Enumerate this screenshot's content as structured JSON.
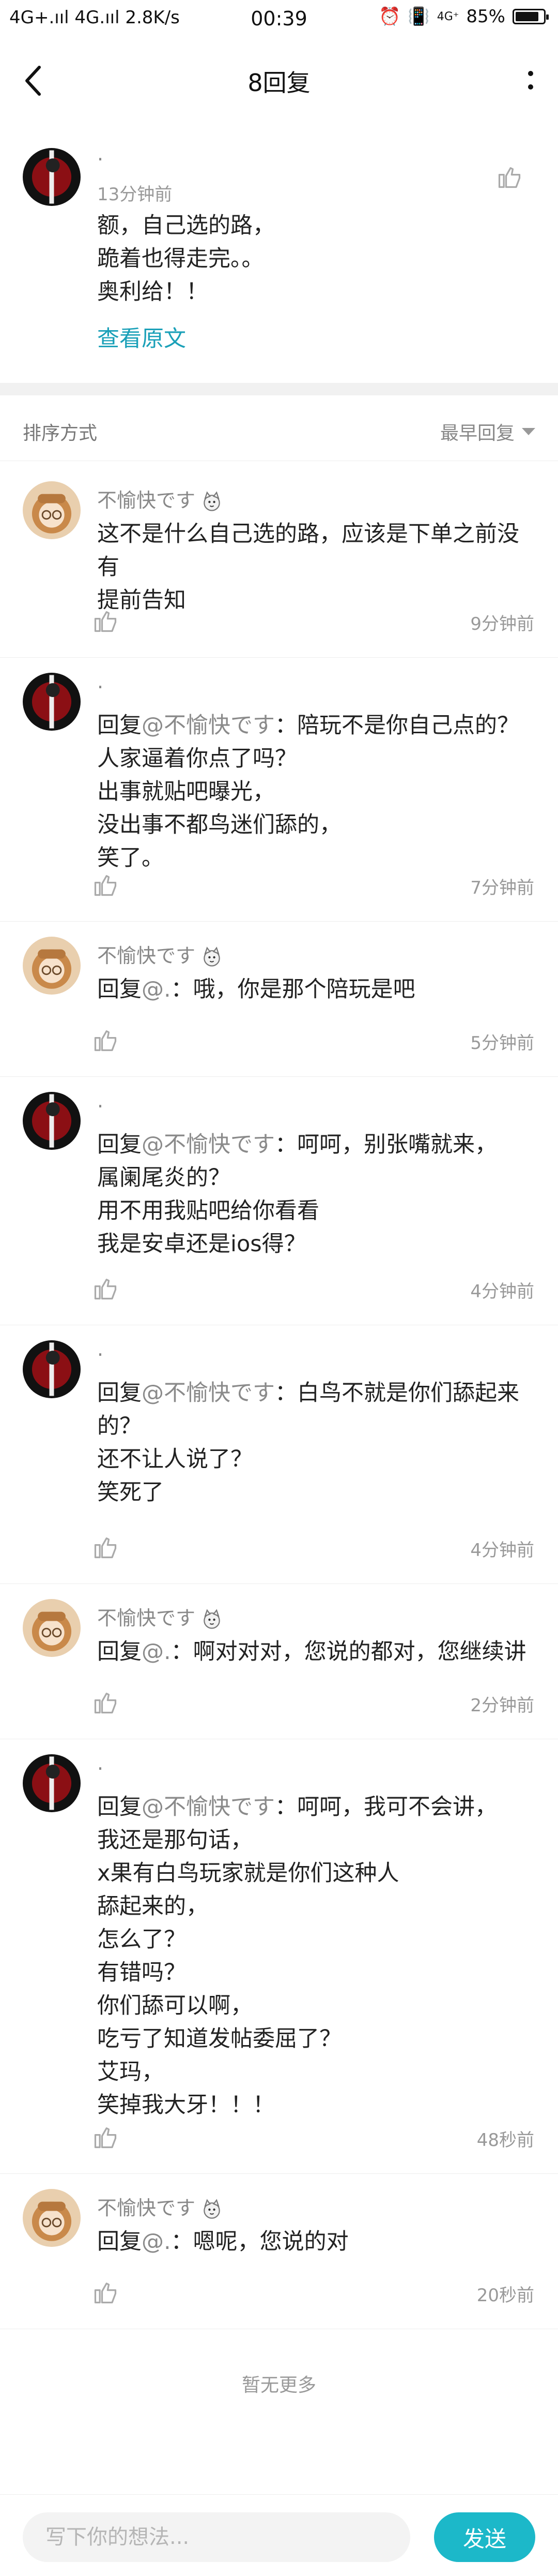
{
  "status_bar": {
    "network_left": "4G+.ııl 4G.ııl 2.8K/s",
    "time": "00:39",
    "network_right": "4G⁺",
    "battery": "85%",
    "battery_level": 0.85
  },
  "nav": {
    "title": "8回复"
  },
  "main_post": {
    "author": "·",
    "time": "13分钟前",
    "lines": [
      "额，自己选的路，",
      "跪着也得走完。。",
      "奥利给！！"
    ],
    "view_original": "查看原文"
  },
  "sort": {
    "label": "排序方式",
    "selected": "最早回复"
  },
  "replies": [
    {
      "author": "不愉快です",
      "prefix": "",
      "mention": "",
      "lines": [
        "这不是什么自己选的路，应该是下单之前没有",
        "提前告知"
      ],
      "time": "9分钟前"
    },
    {
      "author": "·",
      "prefix": "回复",
      "mention": "@不愉快です",
      "lines": [
        "：陪玩不是你自己点的？",
        "人家逼着你点了吗？",
        "出事就贴吧曝光，",
        "没出事不都鸟迷们舔的，",
        "笑了。"
      ],
      "time": "7分钟前"
    },
    {
      "author": "不愉快です",
      "prefix": "回复",
      "mention": "@.",
      "lines": [
        "：哦，你是那个陪玩是吧"
      ],
      "time": "5分钟前"
    },
    {
      "author": "·",
      "prefix": "回复",
      "mention": "@不愉快です",
      "lines": [
        "：呵呵，别张嘴就来，",
        "属阑尾炎的？",
        "用不用我贴吧给你看看",
        "我是安卓还是ios得？"
      ],
      "time": "4分钟前"
    },
    {
      "author": "·",
      "prefix": "回复",
      "mention": "@不愉快です",
      "lines": [
        "：白鸟不就是你们舔起来",
        "的？",
        "还不让人说了？",
        "笑死了"
      ],
      "time": "4分钟前"
    },
    {
      "author": "不愉快です",
      "prefix": "回复",
      "mention": "@.",
      "lines": [
        "：啊对对对，您说的都对，您继续讲"
      ],
      "time": "2分钟前"
    },
    {
      "author": "·",
      "prefix": "回复",
      "mention": "@不愉快です",
      "lines": [
        "：呵呵，我可不会讲，",
        "我还是那句话，",
        "x果有白鸟玩家就是你们这种人",
        "舔起来的，",
        "怎么了？",
        "有错吗？",
        "你们舔可以啊，",
        "吃亏了知道发帖委屈了？",
        "艾玛，",
        "笑掉我大牙！！！"
      ],
      "time": "48秒前"
    },
    {
      "author": "不愉快です",
      "prefix": "回复",
      "mention": "@.",
      "lines": [
        "：嗯呢，您说的对"
      ],
      "time": "20秒前"
    }
  ],
  "footer": {
    "no_more": "暂无更多"
  },
  "input": {
    "placeholder": "写下你的想法...",
    "send": "发送"
  },
  "colors": {
    "accent": "#1cb8c9",
    "link": "#1aa0b8",
    "background": "#ffffff"
  }
}
